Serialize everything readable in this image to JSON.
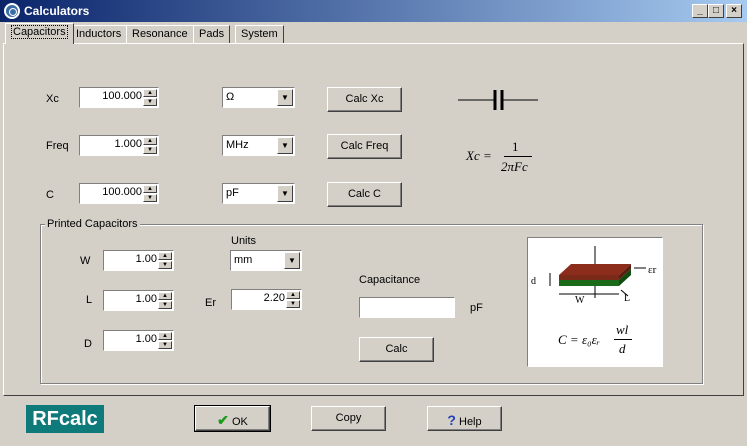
{
  "window": {
    "title": "Calculators",
    "controls": [
      "_",
      "□",
      "×"
    ]
  },
  "tabs": [
    {
      "label": "Capacitors",
      "active": true
    },
    {
      "label": "Inductors"
    },
    {
      "label": "Resonance"
    },
    {
      "label": "Pads"
    },
    {
      "label": "System"
    }
  ],
  "calc": {
    "xc": {
      "label": "Xc",
      "value": "100.000",
      "unit": "Ω",
      "button": "Calc Xc"
    },
    "freq": {
      "label": "Freq",
      "value": "1.000",
      "unit": "MHz",
      "button": "Calc Freq"
    },
    "c": {
      "label": "C",
      "value": "100.000",
      "unit": "pF",
      "button": "Calc C"
    },
    "formula": {
      "lhs": "Xc =",
      "num": "1",
      "den": "2πFc"
    }
  },
  "printed": {
    "title": "Printed Capacitors",
    "w": {
      "label": "W",
      "value": "1.00"
    },
    "l": {
      "label": "L",
      "value": "1.00"
    },
    "d": {
      "label": "D",
      "value": "1.00"
    },
    "units": {
      "label": "Units",
      "value": "mm"
    },
    "er": {
      "label": "Er",
      "value": "2.20"
    },
    "capacitance": {
      "label": "Capacitance",
      "value": "",
      "unit": "pF"
    },
    "calc_button": "Calc",
    "diagram": {
      "d": "d",
      "w": "W",
      "l": "L",
      "er": "εr",
      "formula_lhs": "C = ε₀εᵣ",
      "formula_num": "wl",
      "formula_den": "d"
    }
  },
  "footer": {
    "logo": "RFcalc",
    "ok": "OK",
    "copy": "Copy",
    "help": "Help"
  },
  "colors": {
    "title_start": "#0a246a",
    "title_end": "#a6caf0",
    "logo_bg": "#0f7a7a",
    "ok_check": "#1a9a1a",
    "help_icon": "#1f3fbf"
  }
}
